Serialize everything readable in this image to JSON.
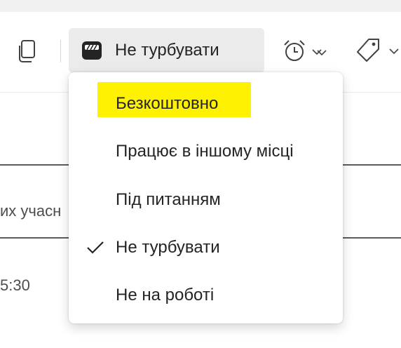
{
  "toolbar": {
    "status_label": "Не турбувати"
  },
  "background": {
    "row_text_1": "их учасн",
    "row_text_2": "5:30"
  },
  "menu": {
    "items": [
      {
        "label": "Безкоштовно",
        "highlighted": true,
        "checked": false
      },
      {
        "label": "Працює в іншому місці",
        "highlighted": false,
        "checked": false
      },
      {
        "label": "Під питанням",
        "highlighted": false,
        "checked": false
      },
      {
        "label": "Не турбувати",
        "highlighted": false,
        "checked": true
      },
      {
        "label": "Не на роботі",
        "highlighted": false,
        "checked": false
      }
    ]
  },
  "colors": {
    "highlight": "#fff200",
    "status_button_bg": "#ebebeb",
    "text": "#242424"
  }
}
